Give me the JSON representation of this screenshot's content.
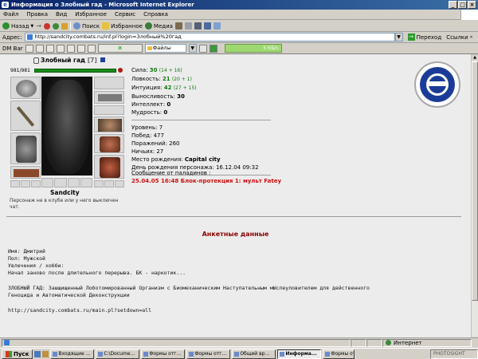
{
  "window": {
    "title": "Информация о Злобный гад - Microsoft Internet Explorer",
    "buttons": [
      "_",
      "□",
      "×"
    ]
  },
  "menu": [
    "Файл",
    "Правка",
    "Вид",
    "Избранное",
    "Сервис",
    "Справка"
  ],
  "toolbar": {
    "back": "Назад",
    "search": "Поиск",
    "favorites": "Избранное",
    "media": "Медиа"
  },
  "addressbar": {
    "label": "Адрес:",
    "url": "http://sandcity.combats.ru/inf.pl?login=Злобный%20гад",
    "go": "Переход",
    "links": "Ссылки"
  },
  "dmbar": {
    "label": "DM Bar",
    "select": "Файлы",
    "counter": "5 КБ/с"
  },
  "character": {
    "name": "Злобный гад",
    "level": "[7]",
    "hp": "981/981",
    "city_label": "Sandcity",
    "note": "Персонаж не в клубе или у него выключен чат."
  },
  "stats": {
    "sila_label": "Сила:",
    "sila_val": "30",
    "sila_extra": "(14 + 16)",
    "lovkost_label": "Ловкость:",
    "lovkost_val": "21",
    "lovkost_extra": "(20 + 1)",
    "intuit_label": "Интуиция:",
    "intuit_val": "42",
    "intuit_extra": "(27 + 15)",
    "vynosl_label": "Выносливость:",
    "vynosl_val": "30",
    "intel_label": "Интеллект:",
    "intel_val": "0",
    "mudrost_label": "Мудрость:",
    "mudrost_val": "0"
  },
  "record": {
    "uroven": "Уровень: 7",
    "pobed": "Побед: 477",
    "porazh": "Поражений: 260",
    "nich": "Ничьих: 27",
    "birth_place_label": "Место рождения:",
    "birth_place": "Capital city",
    "birthday": "День рождения персонажа: 16.12.04 09:32"
  },
  "paladins": {
    "label": "Сообщение от паладинов :",
    "message": "25.04.05 16:48 Блок-протекция 1: мульт Fatey"
  },
  "anketa": {
    "title": "Анкетные данные",
    "name": "Имя: Дмитрий",
    "sex": "Пол: Мужской",
    "hobby_label": "Увлечения / хобби:",
    "hobby": "Начал заново после длительного перерыва. БК - наркотик...",
    "desc1": "ЗЛОБНЫЙ ГАД: Зашщищенный Лоботомированный Организм с Биомеханическим Наступательным мЫслеуловителем для действенного",
    "desc2": "Геноцида и Автоматической Деконструкции",
    "link": "http://sandcity.combats.ru/main.pl?setdown=all"
  },
  "status": {
    "zone": "Интернет"
  },
  "taskbar": {
    "start": "Пуск",
    "tasks": [
      "Входящие ...",
      "C:\\Docume...",
      "Формы отг...",
      "Формы отг...",
      "Общий вр...",
      "Информа...",
      "Формы отг..."
    ],
    "tray": "PHOTOSIGHT"
  }
}
